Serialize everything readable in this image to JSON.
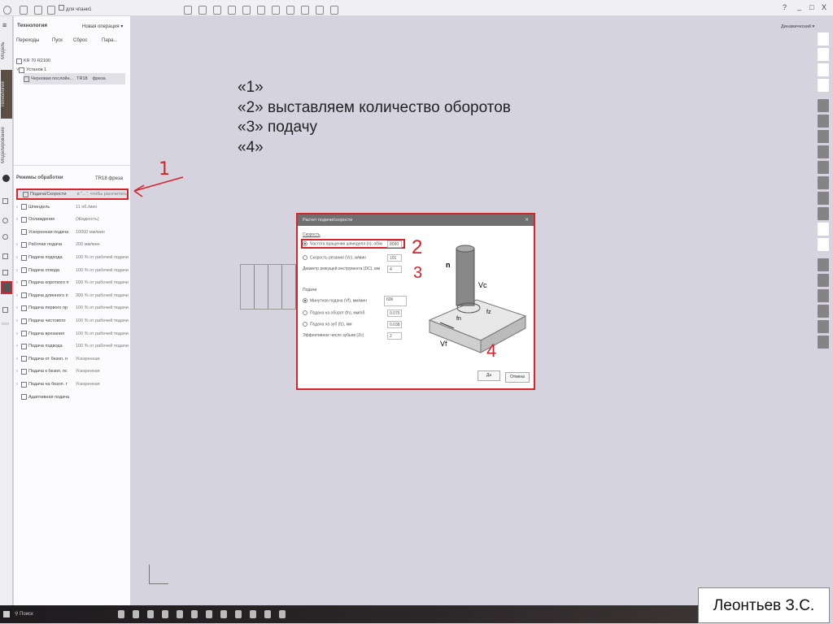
{
  "topbar": {
    "doc_name": "для чпани1",
    "help": "?",
    "minimize": "_",
    "maximize": "□",
    "close": "X"
  },
  "left_tabs": [
    "Модель",
    "Технология",
    "Моделирование"
  ],
  "panel": {
    "title": "Технология",
    "new_op": "Новая операция",
    "toolbar": [
      "Переходы",
      "Пуск",
      "Сброс",
      "Пара..."
    ],
    "tree": [
      {
        "label": "KR 70 R2100"
      },
      {
        "label": "Установ 1"
      },
      {
        "label": "Черновая послойн...",
        "tool": "TR18",
        "type": "фреза"
      }
    ],
    "modes_title": "Режимы обработки",
    "modes_tool": "TR18 фреза",
    "modes": [
      {
        "label": "Подача/Скорости",
        "value": "в \"...\", чтобы рассчитать"
      },
      {
        "label": "Шпиндель",
        "value": "11 об./мин"
      },
      {
        "label": "Охлаждение",
        "value": "(Жидкость)"
      },
      {
        "label": "Ускоренная подача",
        "value": "10000 мм/мин"
      },
      {
        "label": "Рабочая подача",
        "value": "200 мм/мин"
      },
      {
        "label": "Подача подхода",
        "value": "100 % от рабочей подачи"
      },
      {
        "label": "Подача отвода",
        "value": "100 % от рабочей подачи"
      },
      {
        "label": "Подача короткого п",
        "value": "100 % от рабочей подачи"
      },
      {
        "label": "Подача длинного п",
        "value": "300 % от рабочей подачи"
      },
      {
        "label": "Подача первого пр",
        "value": "100 % от рабочей подачи"
      },
      {
        "label": "Подача чистового",
        "value": "100 % от рабочей подачи"
      },
      {
        "label": "Подача врезания",
        "value": "100 % от рабочей подачи"
      },
      {
        "label": "Подача подвода",
        "value": "100 % от рабочей подачи"
      },
      {
        "label": "Подача от безоп. п",
        "value": "Ускоренная"
      },
      {
        "label": "Подача к безоп. пс",
        "value": "Ускоренная"
      },
      {
        "label": "Подача на безоп. г",
        "value": "Ускоренная"
      },
      {
        "label": "Адаптивная подача",
        "value": ""
      }
    ]
  },
  "view_mode": "Динамический",
  "slide_lines": [
    "«1»",
    "«2» выставляем количество оборотов",
    "«3» подачу",
    "«4»"
  ],
  "annotations": [
    "1",
    "2",
    "3",
    "4"
  ],
  "dialog": {
    "title": "Расчет подачи/скорости",
    "speed_section": "Скорость",
    "speed_rows": [
      {
        "label": "Частота вращения шпинделя (n), об/м",
        "value": "8090"
      },
      {
        "label": "Скорость резания (Vc), м/мин",
        "value": "101"
      },
      {
        "label": "Диаметр режущей инструмента (DC), мм",
        "value": "4"
      }
    ],
    "feed_section": "Подачи",
    "feed_rows": [
      {
        "label": "Минутная подача (Vf), мм/мин",
        "value": "606"
      },
      {
        "label": "Подача на оборот (fn), мм/об",
        "value": "0.075"
      },
      {
        "label": "Подача на зуб (fz), мм",
        "value": "0.038"
      },
      {
        "label": "Эффективное число зубьев (Zc)",
        "value": "2"
      }
    ],
    "diagram_labels": [
      "n",
      "Vc",
      "fz",
      "fn",
      "Vf"
    ],
    "ok": "Да",
    "cancel": "Отмена"
  },
  "taskbar": {
    "search": "Поиск"
  },
  "author": "Леонтьев З.С."
}
